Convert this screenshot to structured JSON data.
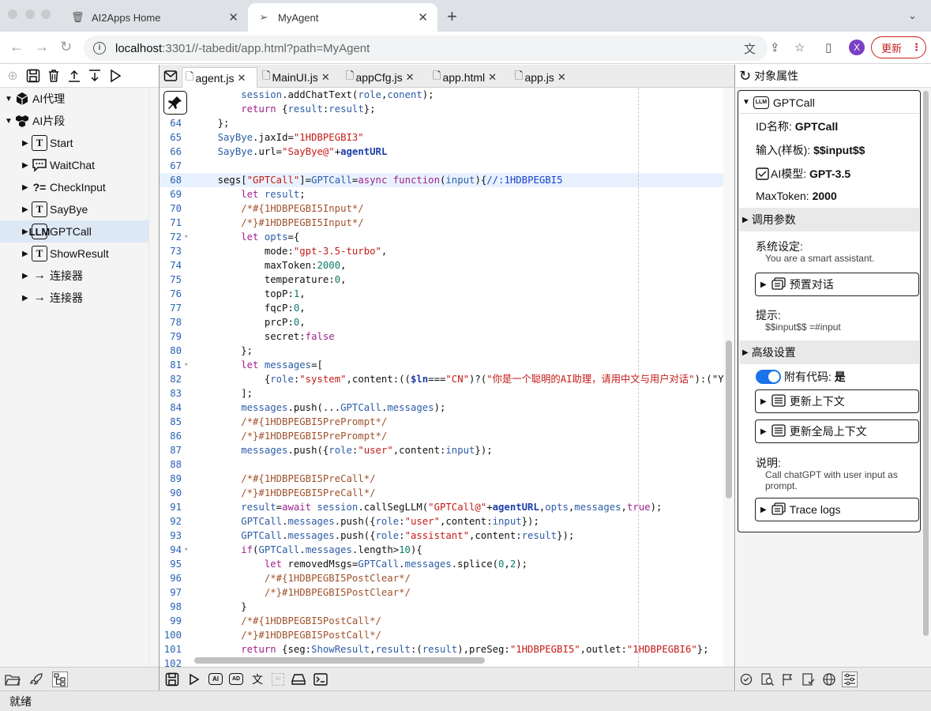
{
  "browser": {
    "tabs": [
      {
        "icon": "trash-icon",
        "title": "AI2Apps Home"
      },
      {
        "icon": "send-icon",
        "title": "MyAgent"
      }
    ],
    "url_host": "localhost",
    "url_path": ":3301//-tabedit/app.html?path=MyAgent",
    "avatar_letter": "X",
    "update_label": "更新"
  },
  "tree": {
    "nodes": [
      {
        "label": "AI代理",
        "icon": "cube-icon",
        "expanded": true,
        "level": 0
      },
      {
        "label": "AI片段",
        "icon": "cubes-icon",
        "expanded": true,
        "level": 0
      },
      {
        "label": "Start",
        "icon": "T",
        "level": 1
      },
      {
        "label": "WaitChat",
        "icon": "chat-icon",
        "level": 1
      },
      {
        "label": "CheckInput",
        "icon": "?=",
        "level": 1
      },
      {
        "label": "SayBye",
        "icon": "T",
        "level": 1
      },
      {
        "label": "GPTCall",
        "icon": "LLM",
        "level": 1,
        "selected": true
      },
      {
        "label": "ShowResult",
        "icon": "T",
        "level": 1
      },
      {
        "label": "连接器",
        "icon": "arrow-icon",
        "level": 1
      },
      {
        "label": "连接器",
        "icon": "arrow-icon",
        "level": 1
      }
    ]
  },
  "editor": {
    "tabs": [
      "agent.js",
      "MainUI.js",
      "appCfg.js",
      "app.html",
      "app.js"
    ],
    "active_tab": "agent.js",
    "lines": [
      {
        "n": "63",
        "t": "        session.addChatText(role,conent);"
      },
      {
        "n": "",
        "t": "        return {result:result};"
      },
      {
        "n": "64",
        "t": "    };"
      },
      {
        "n": "65",
        "t": "    SayBye.jaxId=\"1HDBPEGBI3\""
      },
      {
        "n": "66",
        "t": "    SayBye.url=\"SayBye@\"+agentURL"
      },
      {
        "n": "67",
        "t": ""
      },
      {
        "n": "68",
        "t": "    segs[\"GPTCall\"]=GPTCall=async function(input){//:1HDBPEGBI5",
        "hl": true
      },
      {
        "n": "69",
        "t": "        let result;"
      },
      {
        "n": "70",
        "t": "        /*#{1HDBPEGBI5Input*/"
      },
      {
        "n": "71",
        "t": "        /*}#1HDBPEGBI5Input*/"
      },
      {
        "n": "72",
        "t": "        let opts={",
        "fold": true
      },
      {
        "n": "73",
        "t": "            mode:\"gpt-3.5-turbo\","
      },
      {
        "n": "74",
        "t": "            maxToken:2000,"
      },
      {
        "n": "75",
        "t": "            temperature:0,"
      },
      {
        "n": "76",
        "t": "            topP:1,"
      },
      {
        "n": "77",
        "t": "            fqcP:0,"
      },
      {
        "n": "78",
        "t": "            prcP:0,"
      },
      {
        "n": "79",
        "t": "            secret:false"
      },
      {
        "n": "80",
        "t": "        };"
      },
      {
        "n": "81",
        "t": "        let messages=[",
        "fold": true
      },
      {
        "n": "82",
        "t": "            {role:\"system\",content:(($ln===\"CN\")?(\"你是一个聪明的AI助理，请用中文与用户对话\"):(\"You"
      },
      {
        "n": "83",
        "t": "        ];"
      },
      {
        "n": "84",
        "t": "        messages.push(...GPTCall.messages);"
      },
      {
        "n": "85",
        "t": "        /*#{1HDBPEGBI5PrePrompt*/"
      },
      {
        "n": "86",
        "t": "        /*}#1HDBPEGBI5PrePrompt*/"
      },
      {
        "n": "87",
        "t": "        messages.push({role:\"user\",content:input});"
      },
      {
        "n": "88",
        "t": ""
      },
      {
        "n": "89",
        "t": "        /*#{1HDBPEGBI5PreCall*/"
      },
      {
        "n": "90",
        "t": "        /*}#1HDBPEGBI5PreCall*/"
      },
      {
        "n": "91",
        "t": "        result=await session.callSegLLM(\"GPTCall@\"+agentURL,opts,messages,true);"
      },
      {
        "n": "92",
        "t": "        GPTCall.messages.push({role:\"user\",content:input});"
      },
      {
        "n": "93",
        "t": "        GPTCall.messages.push({role:\"assistant\",content:result});"
      },
      {
        "n": "94",
        "t": "        if(GPTCall.messages.length>10){",
        "fold": true
      },
      {
        "n": "95",
        "t": "            let removedMsgs=GPTCall.messages.splice(0,2);"
      },
      {
        "n": "96",
        "t": "            /*#{1HDBPEGBI5PostClear*/"
      },
      {
        "n": "97",
        "t": "            /*}#1HDBPEGBI5PostClear*/"
      },
      {
        "n": "98",
        "t": "        }"
      },
      {
        "n": "99",
        "t": "        /*#{1HDBPEGBI5PostCall*/"
      },
      {
        "n": "100",
        "t": "        /*}#1HDBPEGBI5PostCall*/"
      },
      {
        "n": "101",
        "t": "        return {seg:ShowResult,result:(result),preSeg:\"1HDBPEGBI5\",outlet:\"1HDBPEGBI6\"};"
      },
      {
        "n": "102",
        "t": ""
      }
    ]
  },
  "props": {
    "header": "对象属性",
    "node_title": "GPTCall",
    "id_label": "ID名称:",
    "id_value": "GPTCall",
    "input_label": "输入(样板):",
    "input_value": "$$input$$",
    "model_label": "AI模型:",
    "model_value": "GPT-3.5",
    "maxtoken_label": "MaxToken:",
    "maxtoken_value": "2000",
    "call_params": "调用参数",
    "system_label": "系统设定:",
    "system_value": "You are a smart assistant.",
    "preset_dialog": "预置对话",
    "prompt_label": "提示:",
    "prompt_value": "$$input$$ =#input",
    "advanced": "高级设置",
    "has_code_label": "附有代码:",
    "has_code_value": "是",
    "update_context": "更新上下文",
    "update_global_context": "更新全局上下文",
    "desc_label": "说明:",
    "desc_value": "Call chatGPT with user input as prompt.",
    "trace_logs": "Trace logs"
  },
  "status": "就绪",
  "colors": {
    "accent": "#1a73e8",
    "update": "#c5221f",
    "selected": "#dde8f5",
    "line_number": "#2a62b4"
  }
}
